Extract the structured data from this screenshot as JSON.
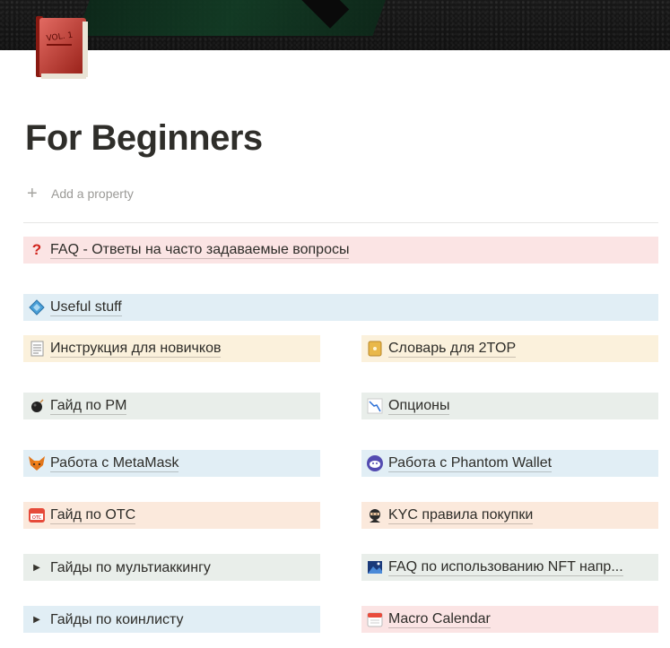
{
  "page": {
    "title": "For Beginners",
    "add_property": "Add a property",
    "page_icon_text": "VOL. 1"
  },
  "blocks": {
    "faq": {
      "label": "FAQ - Ответы на часто задаваемые вопросы",
      "icon": "question-mark-icon"
    },
    "useful": {
      "label": "Useful stuff",
      "icon": "diamond-icon"
    }
  },
  "grid": {
    "left": [
      {
        "label": "Инструкция для новичков",
        "icon": "document-icon"
      },
      {
        "label": "Гайд по PM",
        "icon": "bomb-icon"
      },
      {
        "label": "Работа с MetaMask",
        "icon": "fox-icon"
      },
      {
        "label": "Гайд по OTC",
        "icon": "otc-icon"
      },
      {
        "label": "Гайды по мультиаккингу",
        "icon": "toggle-triangle-icon"
      },
      {
        "label": "Гайды по коинлисту",
        "icon": "toggle-triangle-icon"
      }
    ],
    "right": [
      {
        "label": "Словарь для 2TOP",
        "icon": "note-icon"
      },
      {
        "label": "Опционы",
        "icon": "chart-down-icon"
      },
      {
        "label": "Работа с Phantom Wallet",
        "icon": "ghost-icon"
      },
      {
        "label": "KYC правила покупки",
        "icon": "ninja-icon"
      },
      {
        "label": "FAQ по использованию NFT напр...",
        "icon": "picture-icon"
      },
      {
        "label": "Macro Calendar",
        "icon": "calendar-icon"
      }
    ]
  },
  "colors": {
    "red": "#fbe4e4",
    "blue": "#e1eef5",
    "yellow": "#fbf1dc",
    "green": "#e9eeea",
    "orange": "#fbe9dc"
  }
}
